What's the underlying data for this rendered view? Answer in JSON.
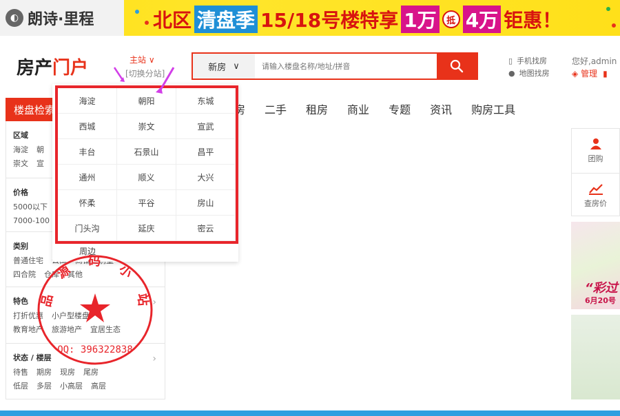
{
  "banner": {
    "brand": "朗诗·里程",
    "promo_prefix": "北区",
    "promo_highlight": "清盘季",
    "promo_middle": "15/18号楼特享",
    "promo_a": "1万",
    "promo_di": "抵",
    "promo_b": "4万",
    "promo_suffix": "钜惠！"
  },
  "header": {
    "logo_black": "房产",
    "logo_red": "门户",
    "station_label": "主站 ∨",
    "station_switch": "[切换分站]",
    "search_select": "新房",
    "search_placeholder": "请输入楼盘名称/地址/拼音",
    "mobile_label": "手机找房",
    "map_label": "地图找房",
    "greeting": "您好,admin",
    "manage_label": "管理",
    "exit_label": "退"
  },
  "nav": {
    "guide": "楼盘检索",
    "items": [
      "房",
      "二手",
      "租房",
      "商业",
      "专题",
      "资讯",
      "购房工具"
    ]
  },
  "filter": {
    "region": {
      "title": "区域",
      "row1": [
        "海淀",
        "朝"
      ],
      "row2": [
        "崇文",
        "宣"
      ]
    },
    "price": {
      "title": "价格",
      "row1": [
        "5000以下"
      ],
      "row2": [
        "7000-100"
      ]
    },
    "type": {
      "title": "类别",
      "row1": [
        "普通住宅",
        "公寓",
        "商铺",
        "别墅"
      ],
      "row2": [
        "四合院",
        "仓库",
        "其他"
      ]
    },
    "feature": {
      "title": "特色",
      "row1": [
        "打折优惠",
        "小户型楼盘"
      ],
      "row2": [
        "教育地产",
        "旅游地产",
        "宜居生态"
      ]
    },
    "status": {
      "title": "状态 / 楼层",
      "row1": [
        "待售",
        "期房",
        "现房",
        "尾房"
      ],
      "row2": [
        "低层",
        "多层",
        "小高层",
        "高层"
      ]
    }
  },
  "districts": [
    "海淀",
    "朝阳",
    "东城",
    "西城",
    "崇文",
    "宣武",
    "丰台",
    "石景山",
    "昌平",
    "通州",
    "顺义",
    "大兴",
    "怀柔",
    "平谷",
    "房山",
    "门头沟",
    "延庆",
    "密云"
  ],
  "extra_district": "周边",
  "side": {
    "group_buy": "团购",
    "check_price": "查房价"
  },
  "ad": {
    "title": "“彩过",
    "date": "6月20号"
  },
  "stamp": {
    "text": "品 源 码 小 站",
    "qq": "QQ: 396322838"
  },
  "colors": {
    "accent": "#e8321a",
    "highlight_frame": "#e8252b",
    "stamp": "#e8252b",
    "arrow": "#d23ee8"
  }
}
